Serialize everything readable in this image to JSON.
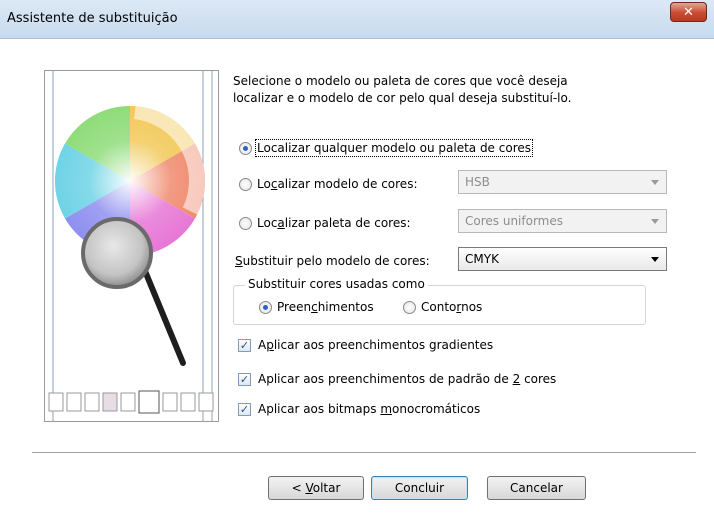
{
  "window": {
    "title": "Assistente de substituição",
    "close_glyph": "✕"
  },
  "intro": {
    "line1": "Selecione o modelo ou paleta de cores que você deseja",
    "line2": "localizar e o modelo de cor pelo qual deseja substituí-lo."
  },
  "options": {
    "any": {
      "label": "Localizar qualquer modelo ou paleta de cores",
      "selected": true
    },
    "model": {
      "label_pre": "Lo",
      "label_u": "c",
      "label_post": "alizar modelo de cores:",
      "value": "HSB"
    },
    "palette": {
      "label_pre": "Loc",
      "label_u": "a",
      "label_post": "lizar paleta de cores:",
      "value": "Cores uniformes"
    }
  },
  "replace": {
    "label_u": "S",
    "label_post": "ubstituir pelo modelo de cores:",
    "value": "CMYK"
  },
  "group": {
    "legend": "Substituir cores usadas como",
    "fills": {
      "label_pre": "Preen",
      "label_u": "c",
      "label_post": "himentos",
      "selected": true
    },
    "outlines": {
      "label_pre": "Conto",
      "label_u": "r",
      "label_post": "nos",
      "selected": false
    }
  },
  "checks": [
    {
      "label_pre": "A",
      "label_u": "p",
      "label_post": "licar aos preenchimentos gradientes",
      "checked": true
    },
    {
      "label_pre": "Aplicar aos preenchimentos de padrão de ",
      "label_u": "2",
      "label_post": " cores",
      "checked": true
    },
    {
      "label_pre": "Aplicar aos bitmaps ",
      "label_u": "m",
      "label_post": "onocromáticos",
      "checked": true
    }
  ],
  "buttons": {
    "back": {
      "label_pre": "< ",
      "label_u": "V",
      "label_post": "oltar"
    },
    "finish": "Concluir",
    "cancel": "Cancelar"
  },
  "icons": {
    "illustration": "color-wheel-magnifier-icon",
    "close": "close-icon",
    "dropdown": "chevron-down-icon",
    "checkmark": "checkmark-icon"
  }
}
